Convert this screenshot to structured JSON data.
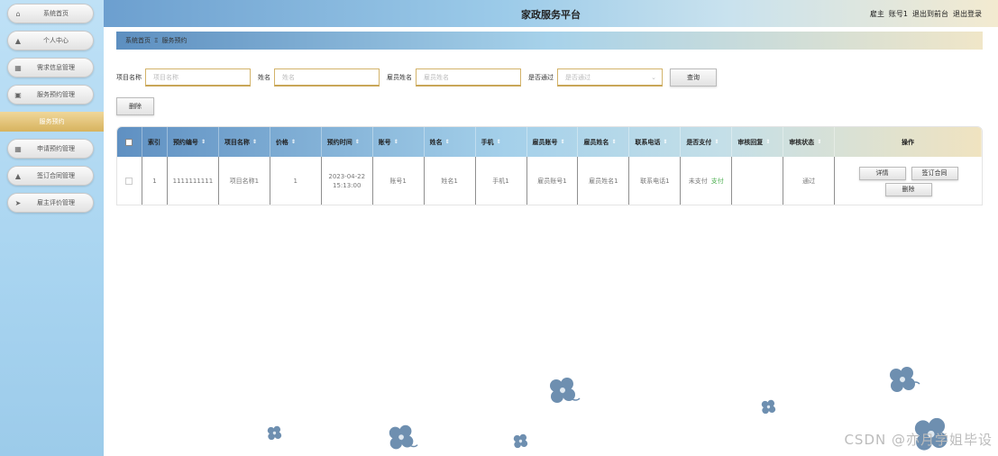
{
  "app": {
    "title": "家政服务平台",
    "user_role": "雇主",
    "user_name": "账号1",
    "back_front_label": "退出到前台",
    "logout_label": "退出登录"
  },
  "sidebar": {
    "items": [
      {
        "label": "系统首页",
        "icon": "home-icon",
        "glyph": "⌂"
      },
      {
        "label": "个人中心",
        "icon": "user-icon",
        "glyph": "▲"
      },
      {
        "label": "需求信息管理",
        "icon": "grid-icon",
        "glyph": "▦"
      },
      {
        "label": "服务预约管理",
        "icon": "building-icon",
        "glyph": "▣"
      },
      {
        "label": "服务预约",
        "sub": true
      },
      {
        "label": "申请预约管理",
        "icon": "grid-icon",
        "glyph": "▦"
      },
      {
        "label": "签订合同管理",
        "icon": "user-icon",
        "glyph": "▲"
      },
      {
        "label": "雇主评价管理",
        "icon": "send-icon",
        "glyph": "➤"
      }
    ]
  },
  "breadcrumb": {
    "home": "系统首页",
    "separator": "Ξ",
    "current": "服务预约"
  },
  "search": {
    "project_name_label": "项目名称",
    "project_name_placeholder": "项目名称",
    "name_label": "姓名",
    "name_placeholder": "姓名",
    "employee_name_label": "雇员姓名",
    "employee_name_placeholder": "雇员姓名",
    "approved_label": "是否通过",
    "approved_placeholder": "是否通过",
    "query_label": "查询"
  },
  "actions": {
    "delete_label": "删除"
  },
  "table": {
    "headers": [
      "索引",
      "预约编号",
      "项目名称",
      "价格",
      "预约时间",
      "账号",
      "姓名",
      "手机",
      "雇员账号",
      "雇员姓名",
      "联系电话",
      "是否支付",
      "审核回复",
      "审核状态",
      "操作"
    ],
    "rows": [
      {
        "index": "1",
        "booking_no": "1111111111",
        "project_name": "项目名称1",
        "price": "1",
        "booking_date": "2023-04-22",
        "booking_time": "15:13:00",
        "account": "账号1",
        "name": "姓名1",
        "phone": "手机1",
        "employee_account": "雇员账号1",
        "employee_name": "雇员姓名1",
        "contact_phone": "联系电话1",
        "paid_status": "未支付",
        "pay_link": "支付",
        "audit_reply": "",
        "audit_status": "通过",
        "ops": {
          "detail": "详情",
          "contract": "签订合同",
          "delete": "删除"
        }
      }
    ]
  },
  "watermark": "CSDN @亦月学姐毕设",
  "colors": {
    "sidebar_bg": "#a8d4f0",
    "active_menu": "#d7b35e",
    "flower": "#6e8fb0",
    "pay_link": "#4caf50"
  }
}
